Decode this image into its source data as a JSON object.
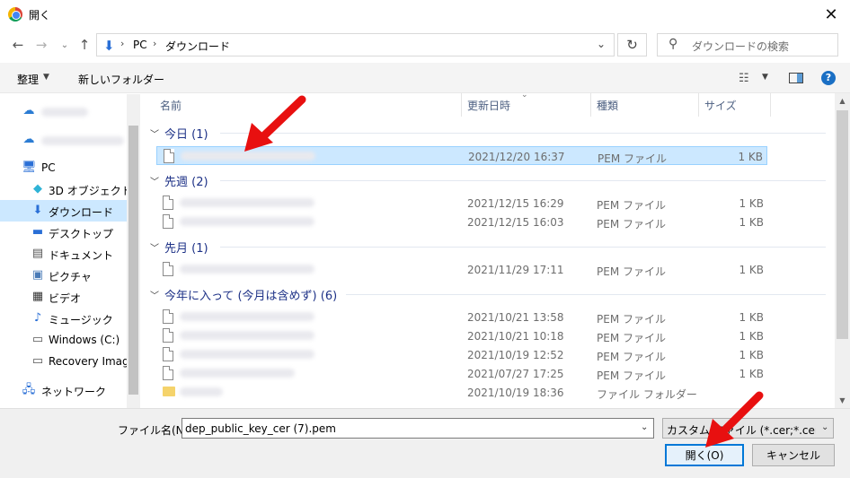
{
  "window": {
    "title": "開く",
    "close_glyph": "✕"
  },
  "nav": {
    "back": "←",
    "forward": "→",
    "recent": "⌄",
    "up": "↑"
  },
  "address": {
    "path_pc": "PC",
    "path_folder": "ダウンロード",
    "separator": "›"
  },
  "search": {
    "placeholder": "ダウンロードの検索"
  },
  "toolbar": {
    "organize_label": "整理",
    "new_folder_label": "新しいフォルダー"
  },
  "sidebar": {
    "items": [
      {
        "label": "",
        "icon": "onedrive-icon",
        "blurred": true
      },
      {
        "label": "",
        "icon": "onedrive-icon",
        "blurred": true
      },
      {
        "label": "PC",
        "icon": "pc-icon"
      },
      {
        "label": "3D オブジェクト",
        "icon": "3d-objects-icon"
      },
      {
        "label": "ダウンロード",
        "icon": "download-icon",
        "selected": true
      },
      {
        "label": "デスクトップ",
        "icon": "desktop-icon"
      },
      {
        "label": "ドキュメント",
        "icon": "documents-icon"
      },
      {
        "label": "ピクチャ",
        "icon": "pictures-icon"
      },
      {
        "label": "ビデオ",
        "icon": "videos-icon"
      },
      {
        "label": "ミュージック",
        "icon": "music-icon"
      },
      {
        "label": "Windows (C:)",
        "icon": "drive-icon"
      },
      {
        "label": "Recovery Image",
        "icon": "drive-icon"
      },
      {
        "label": "ネットワーク",
        "icon": "network-icon"
      }
    ]
  },
  "columns": {
    "name": "名前",
    "date": "更新日時",
    "type": "種類",
    "size": "サイズ"
  },
  "groups": [
    {
      "label": "今日 (1)"
    },
    {
      "label": "先週 (2)"
    },
    {
      "label": "先月 (1)"
    },
    {
      "label": "今年に入って (今月は含めず) (6)"
    }
  ],
  "rows": [
    {
      "date": "2021/12/20 16:37",
      "type": "PEM ファイル",
      "size": "1 KB",
      "selected": true
    },
    {
      "date": "2021/12/15 16:29",
      "type": "PEM ファイル",
      "size": "1 KB"
    },
    {
      "date": "2021/12/15 16:03",
      "type": "PEM ファイル",
      "size": "1 KB"
    },
    {
      "date": "2021/11/29 17:11",
      "type": "PEM ファイル",
      "size": "1 KB"
    },
    {
      "date": "2021/10/21 13:58",
      "type": "PEM ファイル",
      "size": "1 KB"
    },
    {
      "date": "2021/10/21 10:18",
      "type": "PEM ファイル",
      "size": "1 KB"
    },
    {
      "date": "2021/10/19 12:52",
      "type": "PEM ファイル",
      "size": "1 KB"
    },
    {
      "date": "2021/07/27 17:25",
      "type": "PEM ファイル",
      "size": "1 KB"
    },
    {
      "date": "2021/10/19 18:36",
      "type": "ファイル フォルダー",
      "size": ""
    }
  ],
  "bottom": {
    "filename_label": "ファイル名(N):",
    "filename_value": "dep_public_key_cer (7).pem",
    "filter_value": "カスタム ファイル (*.cer;*.cert;*.crt;",
    "open_label": "開く(O)",
    "cancel_label": "キャンセル"
  },
  "colors": {
    "selection": "#cce8ff",
    "group_text": "#1e3287",
    "accent": "#0078d7",
    "arrow": "#e81010"
  }
}
